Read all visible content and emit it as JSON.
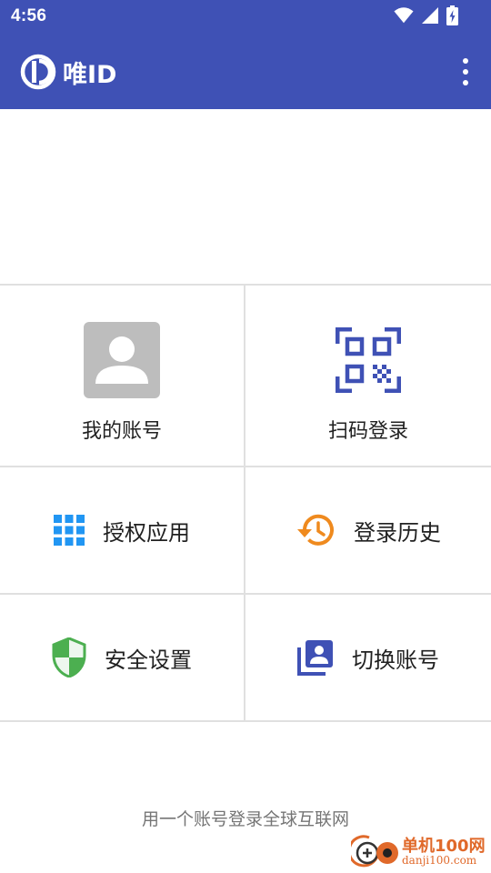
{
  "status_bar": {
    "time": "4:56",
    "icons": [
      "wifi-icon",
      "signal-icon",
      "battery-charging-icon"
    ]
  },
  "app_bar": {
    "title": "唯ID",
    "logo_icon": "weiid-logo-icon",
    "menu_icon": "more-vert-icon"
  },
  "grid": {
    "my_account": {
      "label": "我的账号",
      "icon": "account-avatar-icon"
    },
    "scan_login": {
      "label": "扫码登录",
      "icon": "qr-code-icon"
    },
    "authorized_apps": {
      "label": "授权应用",
      "icon": "apps-grid-icon"
    },
    "login_history": {
      "label": "登录历史",
      "icon": "history-icon"
    },
    "security_settings": {
      "label": "安全设置",
      "icon": "shield-icon"
    },
    "switch_account": {
      "label": "切换账号",
      "icon": "switch-account-icon"
    }
  },
  "footer": {
    "tagline": "用一个账号登录全球互联网"
  },
  "watermark": {
    "name": "单机100网",
    "url": "danji100.com"
  },
  "colors": {
    "primary": "#3f51b5",
    "qr_blue": "#3f51b5",
    "apps_blue": "#2196f3",
    "history_orange": "#ef8a1e",
    "shield_green": "#4caf50",
    "switch_indigo": "#3f51b5",
    "avatar_gray": "#bdbdbd",
    "watermark_orange": "#e0692a"
  }
}
